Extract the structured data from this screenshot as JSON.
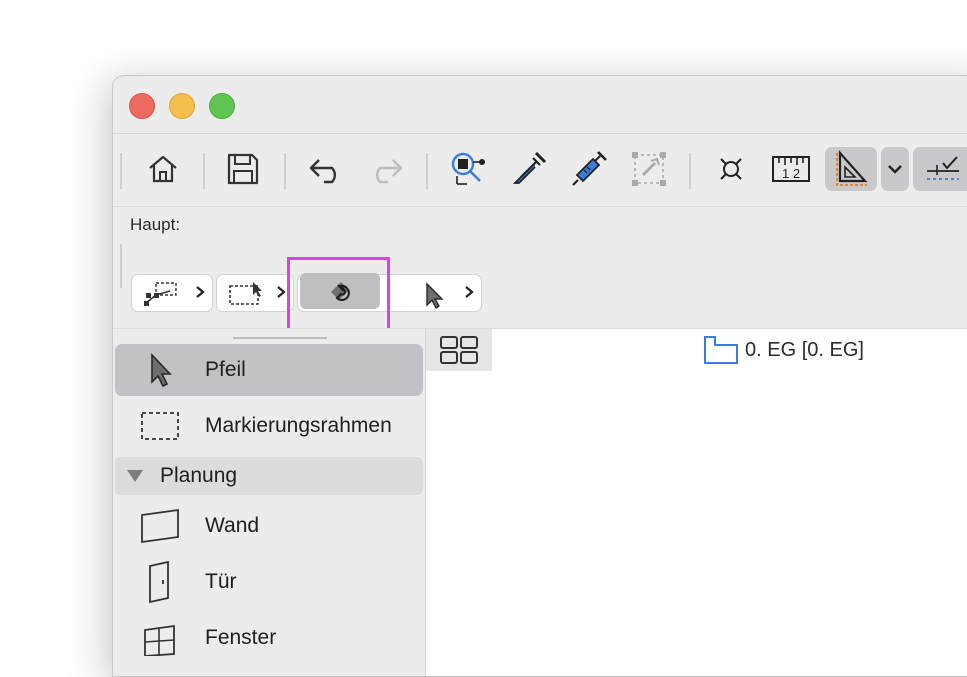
{
  "toolbar": {
    "buttons": [
      {
        "name": "home-icon"
      },
      {
        "name": "save-icon"
      },
      {
        "name": "undo-icon"
      },
      {
        "name": "redo-icon"
      },
      {
        "name": "find-select-icon"
      },
      {
        "name": "pick-up-parameters-icon"
      },
      {
        "name": "inject-parameters-icon"
      },
      {
        "name": "magic-wand-icon"
      },
      {
        "name": "guide-lines-icon"
      },
      {
        "name": "measure-icon"
      },
      {
        "name": "snap-guide-icon"
      },
      {
        "name": "chevron-down-icon"
      },
      {
        "name": "trace-icon"
      }
    ]
  },
  "haupt": {
    "label": "Haupt:"
  },
  "tools": {
    "pfeil": "Pfeil",
    "markierungsrahmen": "Markierungsrahmen",
    "group": "Planung",
    "wand": "Wand",
    "tuer": "Tür",
    "fenster": "Fenster"
  },
  "canvas": {
    "story": "0. EG [0. EG]"
  },
  "colors": {
    "highlight": "#e23ee6",
    "accent_blue": "#3b7ddd",
    "accent_orange": "#e07a2b"
  }
}
